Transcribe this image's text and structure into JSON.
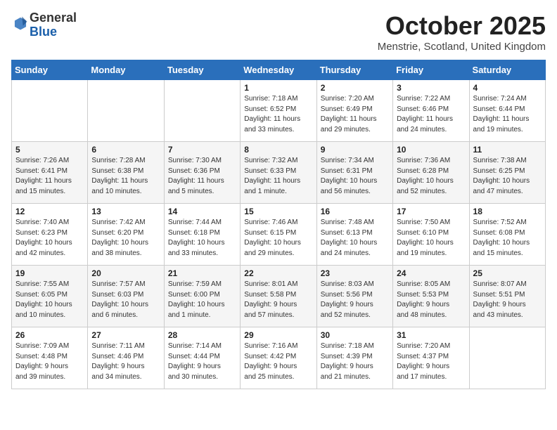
{
  "logo": {
    "general": "General",
    "blue": "Blue"
  },
  "title": "October 2025",
  "subtitle": "Menstrie, Scotland, United Kingdom",
  "days_of_week": [
    "Sunday",
    "Monday",
    "Tuesday",
    "Wednesday",
    "Thursday",
    "Friday",
    "Saturday"
  ],
  "weeks": [
    [
      {
        "day": "",
        "info": ""
      },
      {
        "day": "",
        "info": ""
      },
      {
        "day": "",
        "info": ""
      },
      {
        "day": "1",
        "info": "Sunrise: 7:18 AM\nSunset: 6:52 PM\nDaylight: 11 hours\nand 33 minutes."
      },
      {
        "day": "2",
        "info": "Sunrise: 7:20 AM\nSunset: 6:49 PM\nDaylight: 11 hours\nand 29 minutes."
      },
      {
        "day": "3",
        "info": "Sunrise: 7:22 AM\nSunset: 6:46 PM\nDaylight: 11 hours\nand 24 minutes."
      },
      {
        "day": "4",
        "info": "Sunrise: 7:24 AM\nSunset: 6:44 PM\nDaylight: 11 hours\nand 19 minutes."
      }
    ],
    [
      {
        "day": "5",
        "info": "Sunrise: 7:26 AM\nSunset: 6:41 PM\nDaylight: 11 hours\nand 15 minutes."
      },
      {
        "day": "6",
        "info": "Sunrise: 7:28 AM\nSunset: 6:38 PM\nDaylight: 11 hours\nand 10 minutes."
      },
      {
        "day": "7",
        "info": "Sunrise: 7:30 AM\nSunset: 6:36 PM\nDaylight: 11 hours\nand 5 minutes."
      },
      {
        "day": "8",
        "info": "Sunrise: 7:32 AM\nSunset: 6:33 PM\nDaylight: 11 hours\nand 1 minute."
      },
      {
        "day": "9",
        "info": "Sunrise: 7:34 AM\nSunset: 6:31 PM\nDaylight: 10 hours\nand 56 minutes."
      },
      {
        "day": "10",
        "info": "Sunrise: 7:36 AM\nSunset: 6:28 PM\nDaylight: 10 hours\nand 52 minutes."
      },
      {
        "day": "11",
        "info": "Sunrise: 7:38 AM\nSunset: 6:25 PM\nDaylight: 10 hours\nand 47 minutes."
      }
    ],
    [
      {
        "day": "12",
        "info": "Sunrise: 7:40 AM\nSunset: 6:23 PM\nDaylight: 10 hours\nand 42 minutes."
      },
      {
        "day": "13",
        "info": "Sunrise: 7:42 AM\nSunset: 6:20 PM\nDaylight: 10 hours\nand 38 minutes."
      },
      {
        "day": "14",
        "info": "Sunrise: 7:44 AM\nSunset: 6:18 PM\nDaylight: 10 hours\nand 33 minutes."
      },
      {
        "day": "15",
        "info": "Sunrise: 7:46 AM\nSunset: 6:15 PM\nDaylight: 10 hours\nand 29 minutes."
      },
      {
        "day": "16",
        "info": "Sunrise: 7:48 AM\nSunset: 6:13 PM\nDaylight: 10 hours\nand 24 minutes."
      },
      {
        "day": "17",
        "info": "Sunrise: 7:50 AM\nSunset: 6:10 PM\nDaylight: 10 hours\nand 19 minutes."
      },
      {
        "day": "18",
        "info": "Sunrise: 7:52 AM\nSunset: 6:08 PM\nDaylight: 10 hours\nand 15 minutes."
      }
    ],
    [
      {
        "day": "19",
        "info": "Sunrise: 7:55 AM\nSunset: 6:05 PM\nDaylight: 10 hours\nand 10 minutes."
      },
      {
        "day": "20",
        "info": "Sunrise: 7:57 AM\nSunset: 6:03 PM\nDaylight: 10 hours\nand 6 minutes."
      },
      {
        "day": "21",
        "info": "Sunrise: 7:59 AM\nSunset: 6:00 PM\nDaylight: 10 hours\nand 1 minute."
      },
      {
        "day": "22",
        "info": "Sunrise: 8:01 AM\nSunset: 5:58 PM\nDaylight: 9 hours\nand 57 minutes."
      },
      {
        "day": "23",
        "info": "Sunrise: 8:03 AM\nSunset: 5:56 PM\nDaylight: 9 hours\nand 52 minutes."
      },
      {
        "day": "24",
        "info": "Sunrise: 8:05 AM\nSunset: 5:53 PM\nDaylight: 9 hours\nand 48 minutes."
      },
      {
        "day": "25",
        "info": "Sunrise: 8:07 AM\nSunset: 5:51 PM\nDaylight: 9 hours\nand 43 minutes."
      }
    ],
    [
      {
        "day": "26",
        "info": "Sunrise: 7:09 AM\nSunset: 4:48 PM\nDaylight: 9 hours\nand 39 minutes."
      },
      {
        "day": "27",
        "info": "Sunrise: 7:11 AM\nSunset: 4:46 PM\nDaylight: 9 hours\nand 34 minutes."
      },
      {
        "day": "28",
        "info": "Sunrise: 7:14 AM\nSunset: 4:44 PM\nDaylight: 9 hours\nand 30 minutes."
      },
      {
        "day": "29",
        "info": "Sunrise: 7:16 AM\nSunset: 4:42 PM\nDaylight: 9 hours\nand 25 minutes."
      },
      {
        "day": "30",
        "info": "Sunrise: 7:18 AM\nSunset: 4:39 PM\nDaylight: 9 hours\nand 21 minutes."
      },
      {
        "day": "31",
        "info": "Sunrise: 7:20 AM\nSunset: 4:37 PM\nDaylight: 9 hours\nand 17 minutes."
      },
      {
        "day": "",
        "info": ""
      }
    ]
  ]
}
